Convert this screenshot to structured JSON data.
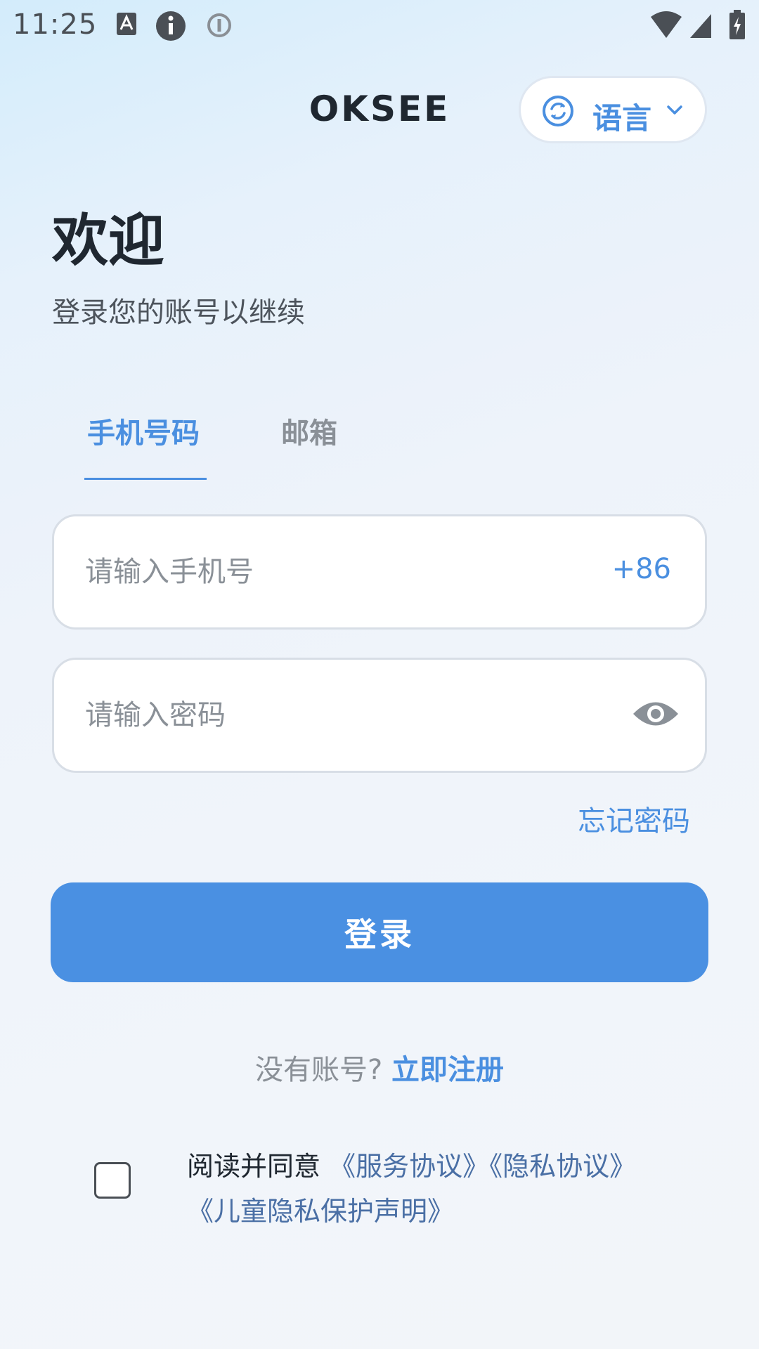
{
  "status_bar": {
    "time": "11:25",
    "icons_left": [
      "a-notification-icon",
      "info-circle-icon",
      "alert-circle-icon"
    ],
    "icons_right": [
      "wifi-icon",
      "signal-icon",
      "battery-charging-icon"
    ]
  },
  "header": {
    "title": "OKSEE",
    "language_label": "语言"
  },
  "welcome": {
    "title": "欢迎",
    "subtitle": "登录您的账号以继续"
  },
  "tabs": [
    {
      "label": "手机号码",
      "active": true
    },
    {
      "label": "邮箱",
      "active": false
    }
  ],
  "form": {
    "phone_placeholder": "请输入手机号",
    "phone_value": "",
    "country_code": "+86",
    "password_placeholder": "请输入密码",
    "password_value": "",
    "forgot_password": "忘记密码",
    "login_button": "登录"
  },
  "register": {
    "prompt": "没有账号?",
    "link": "立即注册"
  },
  "agreement": {
    "checked": false,
    "prefix": "阅读并同意",
    "service": "《服务协议》",
    "privacy": "《隐私协议》",
    "children": "《儿童隐私保护声明》"
  },
  "colors": {
    "accent": "#4a90e2",
    "link": "#4a8fe0",
    "text_primary": "#1f2730",
    "text_muted": "#8a9097"
  }
}
